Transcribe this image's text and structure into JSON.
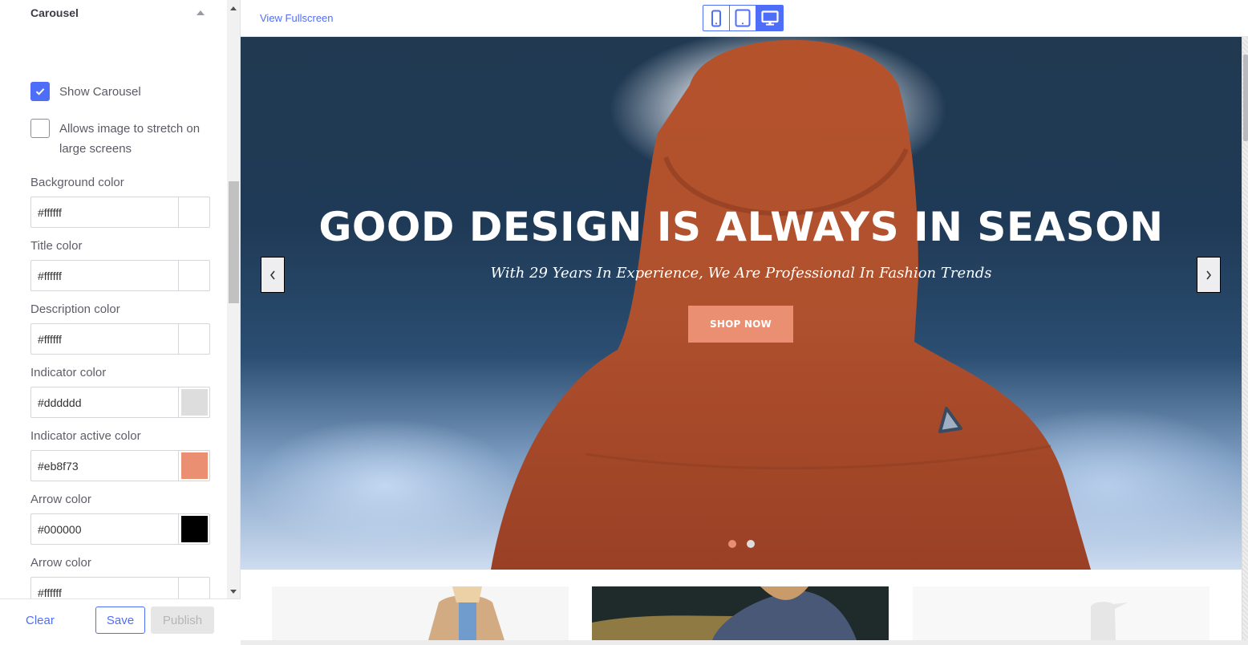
{
  "panel": {
    "section_title": "Carousel",
    "checkboxes": [
      {
        "label": "Show Carousel",
        "checked": true
      },
      {
        "label": "Allows image to stretch on large screens",
        "checked": false
      }
    ],
    "fields": [
      {
        "label": "Background color",
        "value": "#ffffff",
        "swatch": "#ffffff"
      },
      {
        "label": "Title color",
        "value": "#ffffff",
        "swatch": "#ffffff"
      },
      {
        "label": "Description color",
        "value": "#ffffff",
        "swatch": "#ffffff"
      },
      {
        "label": "Indicator color",
        "value": "#dddddd",
        "swatch": "#dddddd"
      },
      {
        "label": "Indicator active color",
        "value": "#eb8f73",
        "swatch": "#eb8f73"
      },
      {
        "label": "Arrow color",
        "value": "#000000",
        "swatch": "#000000"
      },
      {
        "label": "Arrow color",
        "value": "#ffffff",
        "swatch": "#ffffff"
      }
    ],
    "footer": {
      "clear_label": "Clear",
      "save_label": "Save",
      "publish_label": "Publish"
    }
  },
  "preview": {
    "view_fullscreen_label": "View Fullscreen",
    "devices": [
      {
        "name": "mobile",
        "active": false
      },
      {
        "name": "tablet",
        "active": false
      },
      {
        "name": "desktop",
        "active": true
      }
    ],
    "accent_color": "#4f6ef7",
    "carousel": {
      "title": "GOOD DESIGN IS ALWAYS IN SEASON",
      "description": "With 29 Years In Experience, We Are Professional In Fashion Trends",
      "button_label": "SHOP NOW",
      "button_color": "#eb8f73",
      "prev_icon": "chevron-left-icon",
      "next_icon": "chevron-right-icon",
      "slides_count": 2,
      "active_slide": 1,
      "indicator_color": "#dddddd",
      "indicator_active_color": "#eb8f73"
    }
  }
}
